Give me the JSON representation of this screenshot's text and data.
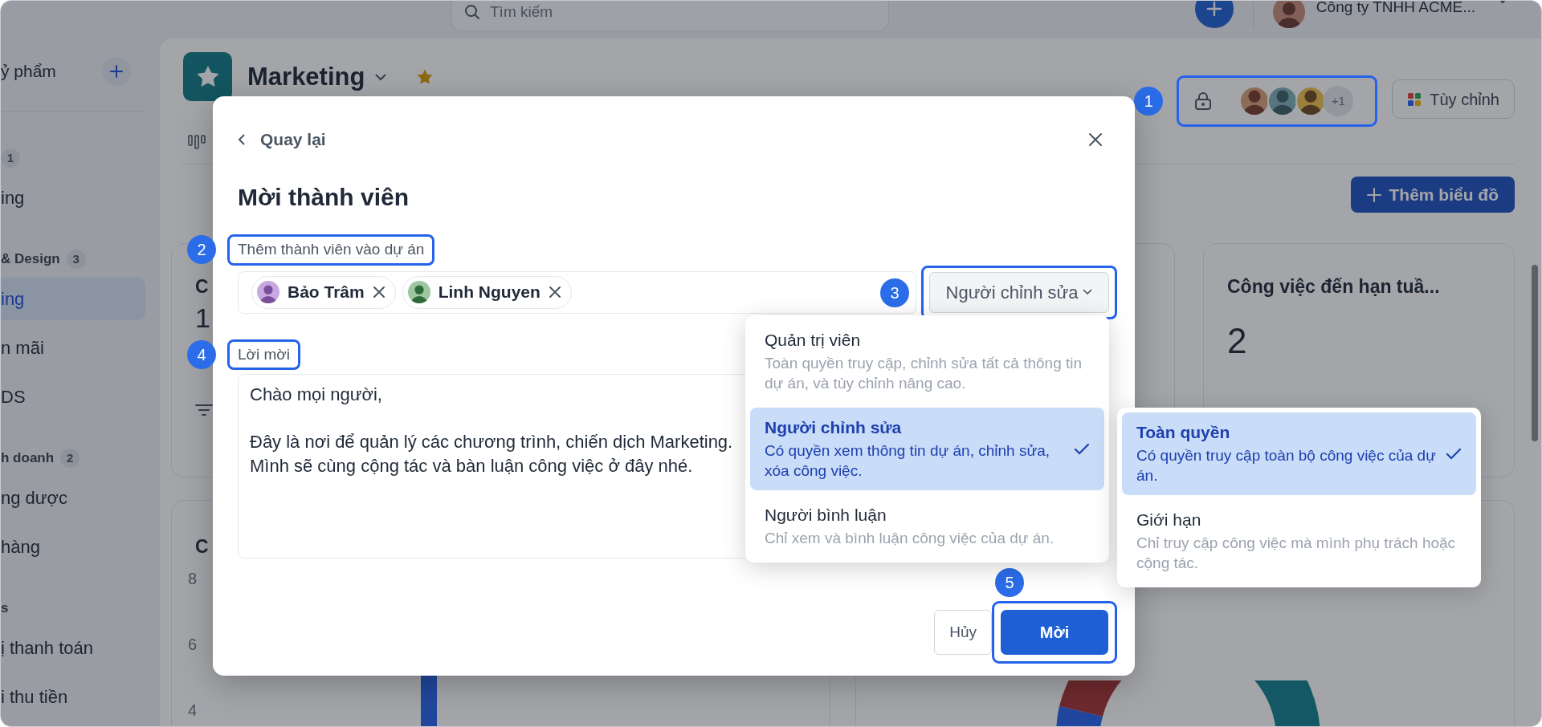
{
  "topbar": {
    "search": {
      "placeholder": "Tìm kiếm"
    },
    "company": "Công ty TNHH ACME..."
  },
  "sidebar": {
    "workspace": "ỷ phẩm",
    "groups": [
      {
        "count": "1",
        "items": [
          {
            "label": "ing",
            "selected": false
          }
        ]
      },
      {
        "title": "& Design",
        "count": "3",
        "items": [
          {
            "label": "ing",
            "selected": true
          },
          {
            "label": "n mãi",
            "selected": false
          },
          {
            "label": "DS",
            "selected": false
          }
        ]
      },
      {
        "title": "h doanh",
        "count": "2",
        "items": [
          {
            "label": "ng dược",
            "selected": false
          },
          {
            "label": "hàng",
            "selected": false
          }
        ]
      },
      {
        "title": "s",
        "items": [
          {
            "label": "ị thanh toán",
            "selected": false
          },
          {
            "label": "i thu tiền",
            "selected": false
          }
        ]
      }
    ]
  },
  "project": {
    "name": "Marketing",
    "starred": true,
    "members": {
      "step": "1",
      "more": "+1"
    },
    "customize_button": "Tùy chỉnh",
    "add_chart_button": "Thêm biểu đồ"
  },
  "cards": [
    {
      "title": "C",
      "value": "1"
    },
    {
      "title": "Công việc đến hạn tuầ...",
      "value": "2"
    }
  ],
  "bottom_cards": [
    {
      "kind": "bar",
      "title": "C",
      "y_ticks": [
        "8",
        "6",
        "4"
      ]
    },
    {
      "kind": "donut"
    }
  ],
  "modal": {
    "back": "Quay lại",
    "title": "Mời thành viên",
    "members_label": {
      "text": "Thêm thành viên vào dự án",
      "step": "2"
    },
    "invitees": [
      {
        "name": "Bảo Trâm"
      },
      {
        "name": "Linh Nguyen"
      }
    ],
    "role_button": {
      "text": "Người chỉnh sửa",
      "step": "3"
    },
    "message_label": {
      "text": "Lời mời",
      "step": "4"
    },
    "message": "Chào mọi người,\n\nĐây là nơi để quản lý các chương trình, chiến dịch Marketing.\nMình sẽ cùng cộng tác và bàn luận công việc ở đây nhé.",
    "roles": [
      {
        "title": "Quản trị viên",
        "description": "Toàn quyền truy cập, chỉnh sửa tất cả thông tin dự án, và tùy chỉnh nâng cao.",
        "selected": false
      },
      {
        "title": "Người chỉnh sửa",
        "description": "Có quyền xem thông tin dự án, chỉnh sửa, xóa công việc.",
        "selected": true
      },
      {
        "title": "Người bình luận",
        "description": "Chỉ xem và bình luận công việc của dự án.",
        "selected": false
      }
    ],
    "access": [
      {
        "title": "Toàn quyền",
        "description": "Có quyền truy cập toàn bộ công việc của dự án.",
        "selected": true
      },
      {
        "title": "Giới hạn",
        "description": "Chỉ truy cập công việc mà mình phụ trách hoặc cộng tác.",
        "selected": false
      }
    ],
    "cancel": "Hủy",
    "submit": {
      "text": "Mời",
      "step": "5"
    }
  }
}
